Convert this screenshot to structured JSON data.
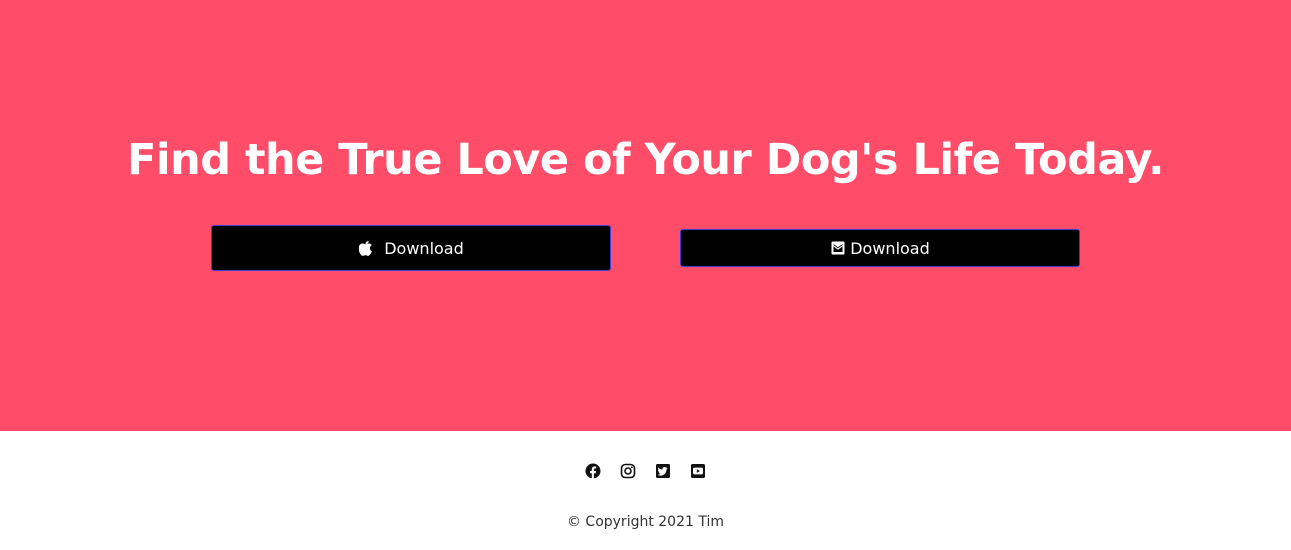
{
  "cta": {
    "background_color": "#ff4c68",
    "title": "Find the True Love of Your Dog's Life Today.",
    "buttons": [
      {
        "label": "Download",
        "icon": "apple-icon"
      },
      {
        "label": "Download",
        "icon": "envelope-icon"
      }
    ]
  },
  "footer": {
    "social": [
      {
        "icon": "facebook-icon"
      },
      {
        "icon": "instagram-icon"
      },
      {
        "icon": "twitter-icon"
      },
      {
        "icon": "youtube-icon"
      }
    ],
    "copyright": "© Copyright 2021 Tim"
  }
}
